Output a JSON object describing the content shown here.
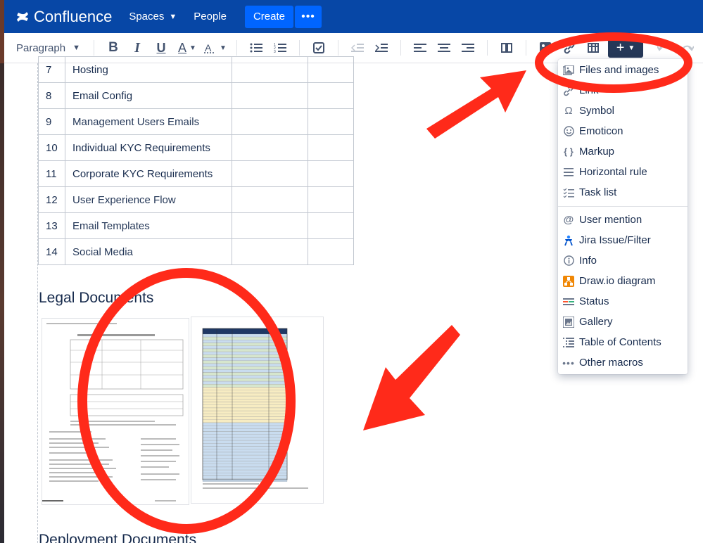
{
  "nav": {
    "brand": "Confluence",
    "spaces": "Spaces",
    "people": "People",
    "create": "Create",
    "more": "•••"
  },
  "toolbar": {
    "paragraph": "Paragraph",
    "bold": "B",
    "italic": "I",
    "underline": "U",
    "text_color": "A",
    "insert": "+"
  },
  "table": {
    "rows": [
      {
        "num": "7",
        "name": "Hosting"
      },
      {
        "num": "8",
        "name": "Email Config"
      },
      {
        "num": "9",
        "name": "Management Users Emails"
      },
      {
        "num": "10",
        "name": "Individual KYC Requirements"
      },
      {
        "num": "11",
        "name": "Corporate KYC Requirements"
      },
      {
        "num": "12",
        "name": "User Experience Flow"
      },
      {
        "num": "13",
        "name": "Email Templates"
      },
      {
        "num": "14",
        "name": "Social Media"
      }
    ]
  },
  "sections": {
    "legal": "Legal Documents",
    "deployment": "Deployment Documents"
  },
  "insert_menu": {
    "items": [
      {
        "label": "Files and images",
        "icon": "image-file-icon"
      },
      {
        "label": "Link",
        "icon": "link-icon"
      },
      {
        "label": "Symbol",
        "icon": "omega-icon"
      },
      {
        "label": "Emoticon",
        "icon": "smiley-icon"
      },
      {
        "label": "Markup",
        "icon": "braces-icon"
      },
      {
        "label": "Horizontal rule",
        "icon": "hr-icon"
      },
      {
        "label": "Task list",
        "icon": "task-list-icon"
      },
      {
        "label": "User mention",
        "icon": "at-icon"
      },
      {
        "label": "Jira Issue/Filter",
        "icon": "jira-icon"
      },
      {
        "label": "Info",
        "icon": "info-icon"
      },
      {
        "label": "Draw.io diagram",
        "icon": "drawio-icon"
      },
      {
        "label": "Status",
        "icon": "status-icon"
      },
      {
        "label": "Gallery",
        "icon": "gallery-icon"
      },
      {
        "label": "Table of Contents",
        "icon": "toc-icon"
      },
      {
        "label": "Other macros",
        "icon": "dots-icon"
      }
    ]
  },
  "colors": {
    "nav_bg": "#0747a6",
    "create_bg": "#0065ff",
    "annotation_red": "#ff2a1a"
  }
}
